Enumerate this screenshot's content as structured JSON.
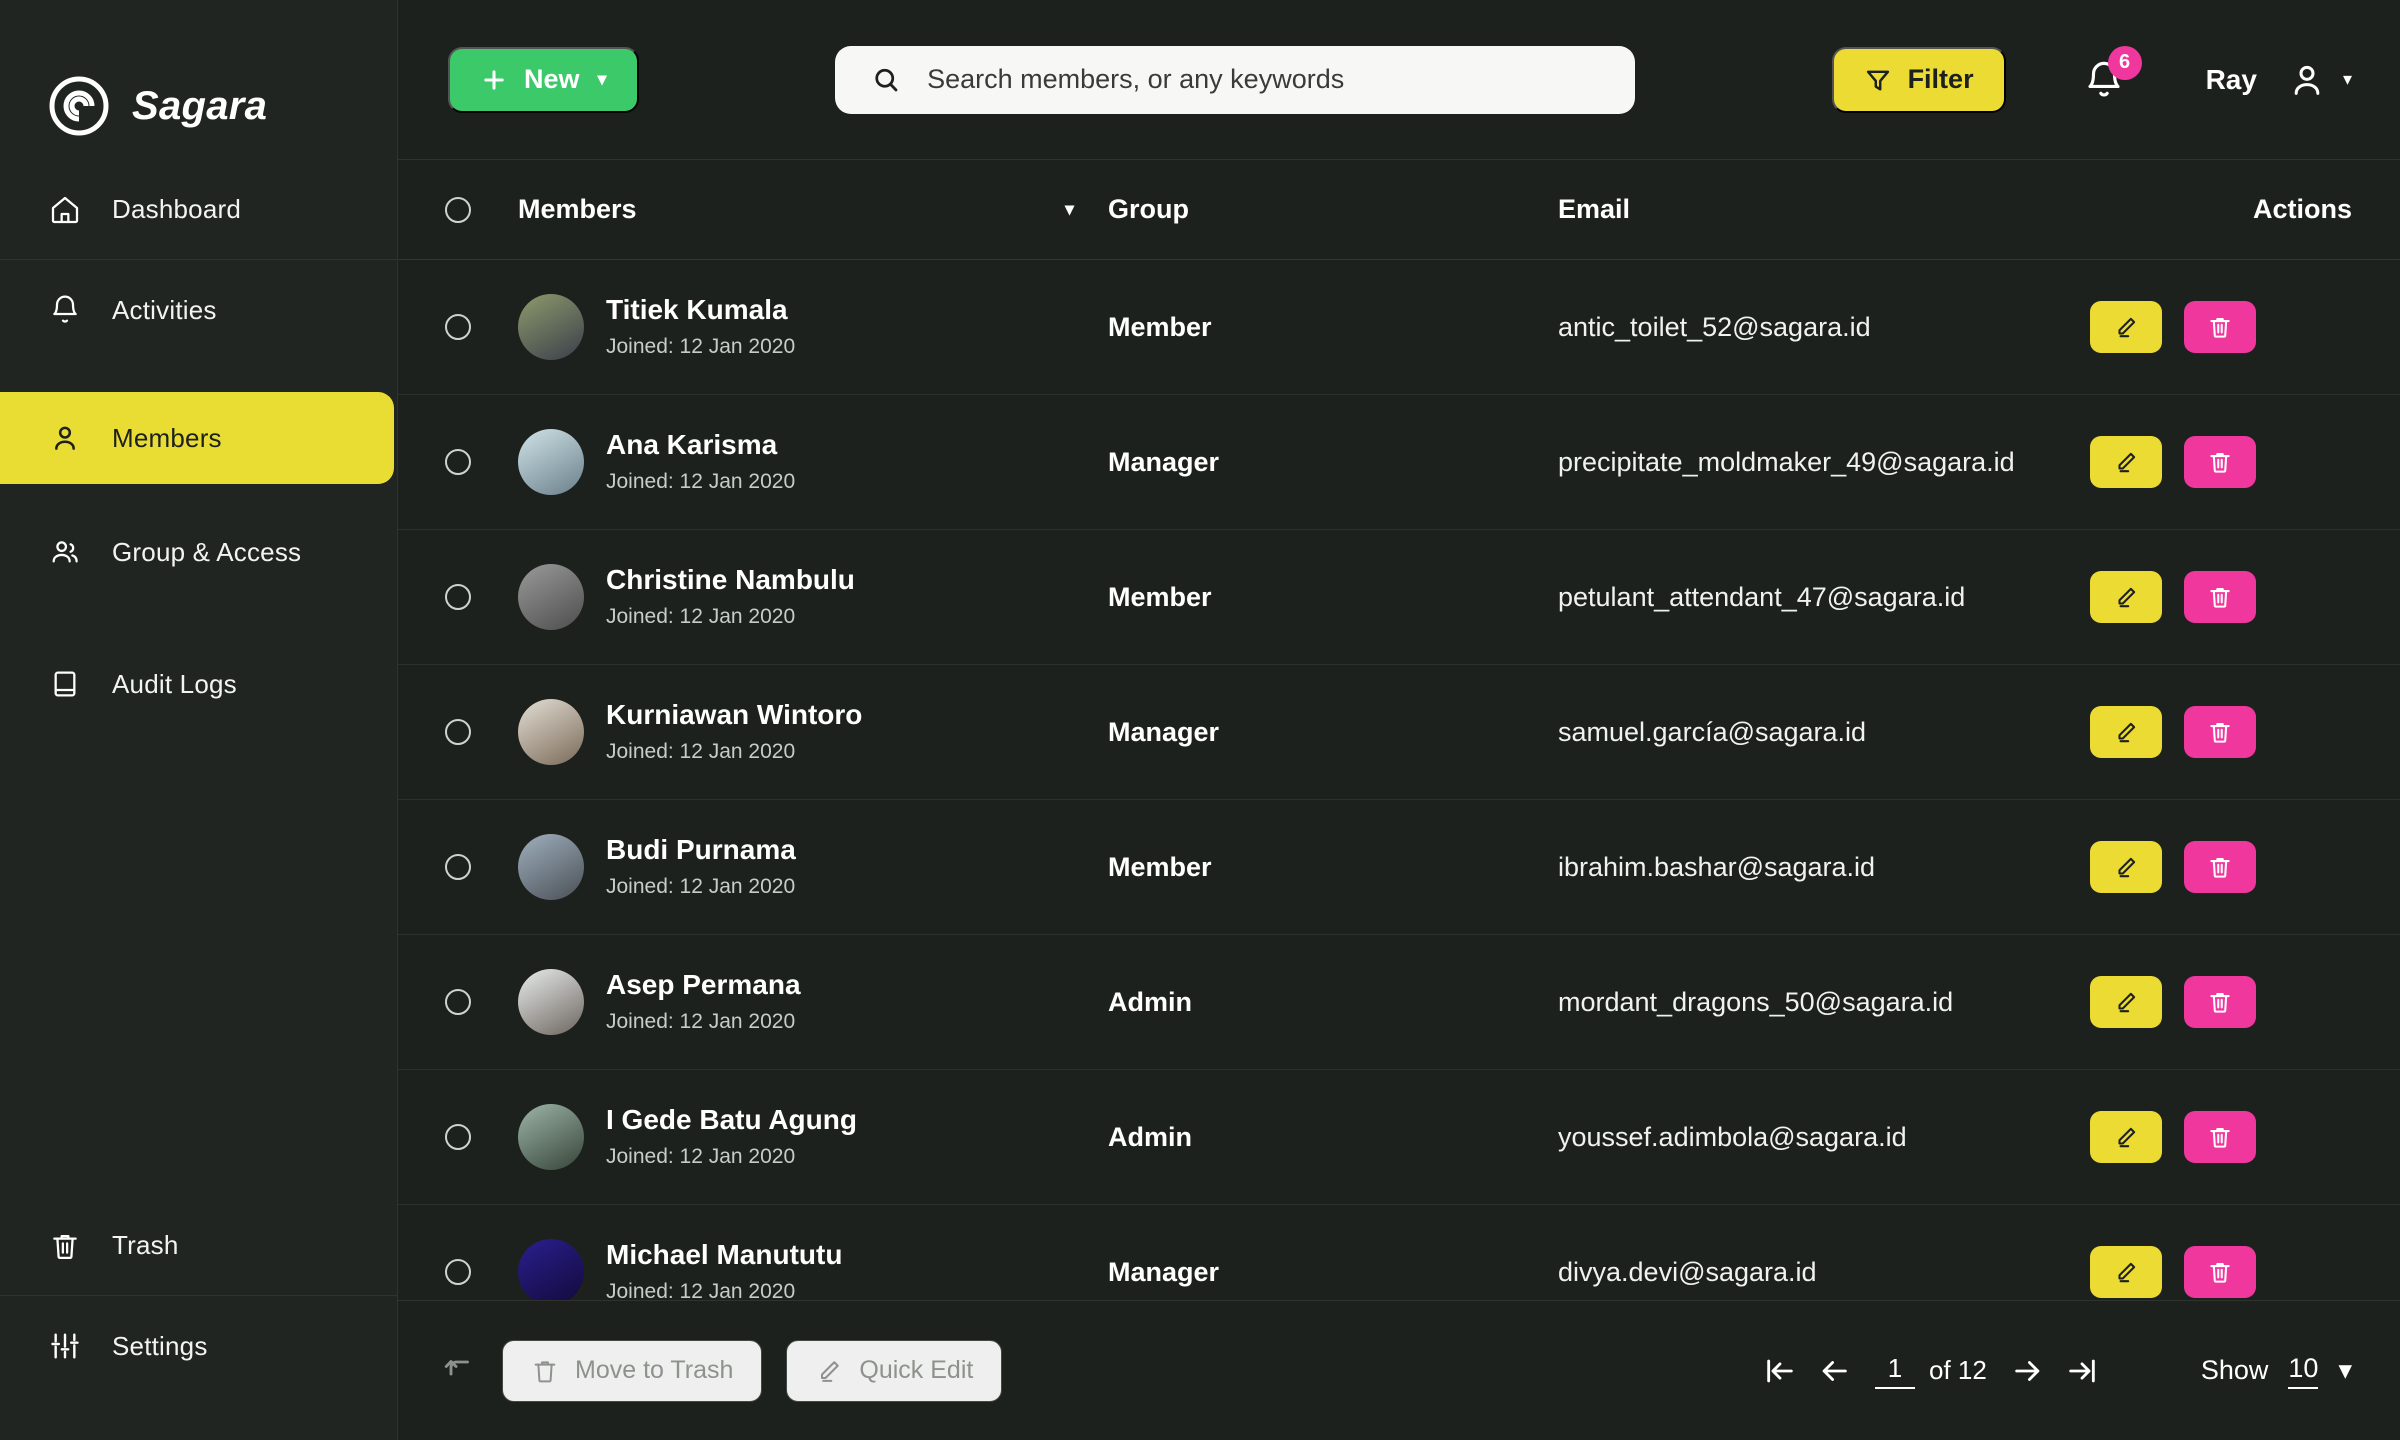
{
  "brand": {
    "name": "Sagara",
    "logo_icon": "spiral-logo-icon"
  },
  "sidebar": {
    "top_items": [
      {
        "label": "Dashboard",
        "icon": "home-icon",
        "active": false
      },
      {
        "label": "Activities",
        "icon": "bell-icon",
        "active": false
      },
      {
        "label": "Members",
        "icon": "user-icon",
        "active": true
      },
      {
        "label": "Group & Access",
        "icon": "users-icon",
        "active": false
      },
      {
        "label": "Audit Logs",
        "icon": "book-icon",
        "active": false
      }
    ],
    "bottom_items": [
      {
        "label": "Trash",
        "icon": "trash-icon"
      },
      {
        "label": "Settings",
        "icon": "sliders-icon"
      }
    ]
  },
  "topbar": {
    "new_label": "New",
    "new_icon": "plus-icon",
    "new_caret": "▾",
    "new_color": "#3bc96a",
    "search_placeholder": "Search members, or any keywords",
    "search_value": "",
    "search_icon": "search-icon",
    "filter_label": "Filter",
    "filter_icon": "funnel-icon",
    "filter_color": "#ecdb33",
    "notification_icon": "bell-icon",
    "notification_count": "6",
    "notification_badge_color": "#f0379e",
    "user_name": "Ray",
    "user_icon": "person-icon",
    "user_caret": "▾"
  },
  "table": {
    "columns": {
      "members": "Members",
      "group": "Group",
      "email": "Email",
      "actions": "Actions"
    },
    "sort_caret": "▾",
    "joined_prefix": "Joined:",
    "edit_icon": "pencil-icon",
    "delete_icon": "trash-icon",
    "edit_color": "#ecdb33",
    "delete_color": "#f0379e",
    "rows": [
      {
        "name": "Titiek Kumala",
        "joined": "Joined: 12 Jan 2020",
        "group": "Member",
        "email": "antic_toilet_52@sagara.id",
        "avatar_from": "#8e9a6d",
        "avatar_to": "#3a3f4a"
      },
      {
        "name": "Ana Karisma",
        "joined": "Joined: 12 Jan 2020",
        "group": "Manager",
        "email": "precipitate_moldmaker_49@sagara.id",
        "avatar_from": "#cfe3e6",
        "avatar_to": "#6b7f8c"
      },
      {
        "name": "Christine Nambulu",
        "joined": "Joined: 12 Jan 2020",
        "group": "Member",
        "email": "petulant_attendant_47@sagara.id",
        "avatar_from": "#9a9a9a",
        "avatar_to": "#4d4d4d"
      },
      {
        "name": "Kurniawan Wintoro",
        "joined": "Joined: 12 Jan 2020",
        "group": "Manager",
        "email": "samuel.garcía@sagara.id",
        "avatar_from": "#e3ded4",
        "avatar_to": "#7a6a58"
      },
      {
        "name": "Budi Purnama",
        "joined": "Joined: 12 Jan 2020",
        "group": "Member",
        "email": "ibrahim.bashar@sagara.id",
        "avatar_from": "#9fb0bd",
        "avatar_to": "#4a4f56"
      },
      {
        "name": "Asep Permana",
        "joined": "Joined: 12 Jan 2020",
        "group": "Admin",
        "email": "mordant_dragons_50@sagara.id",
        "avatar_from": "#e8ecec",
        "avatar_to": "#6d655e"
      },
      {
        "name": "I Gede Batu Agung",
        "joined": "Joined: 12 Jan 2020",
        "group": "Admin",
        "email": "youssef.adimbola@sagara.id",
        "avatar_from": "#9db5a8",
        "avatar_to": "#364438"
      },
      {
        "name": "Michael Manututu",
        "joined": "Joined: 12 Jan 2020",
        "group": "Manager",
        "email": "divya.devi@sagara.id",
        "avatar_from": "#2a1f8f",
        "avatar_to": "#120a3a"
      }
    ]
  },
  "footer": {
    "undo_icon": "undo-arrow-icon",
    "move_to_trash_label": "Move to Trash",
    "move_to_trash_icon": "trash-icon",
    "quick_edit_label": "Quick Edit",
    "quick_edit_icon": "pencil-icon",
    "pagination": {
      "first_icon": "first-page-icon",
      "prev_icon": "prev-page-icon",
      "current_page": "1",
      "of_label": "of 12",
      "next_icon": "next-page-icon",
      "last_icon": "last-page-icon"
    },
    "show_label": "Show",
    "show_value": "10",
    "show_caret": "▾"
  }
}
